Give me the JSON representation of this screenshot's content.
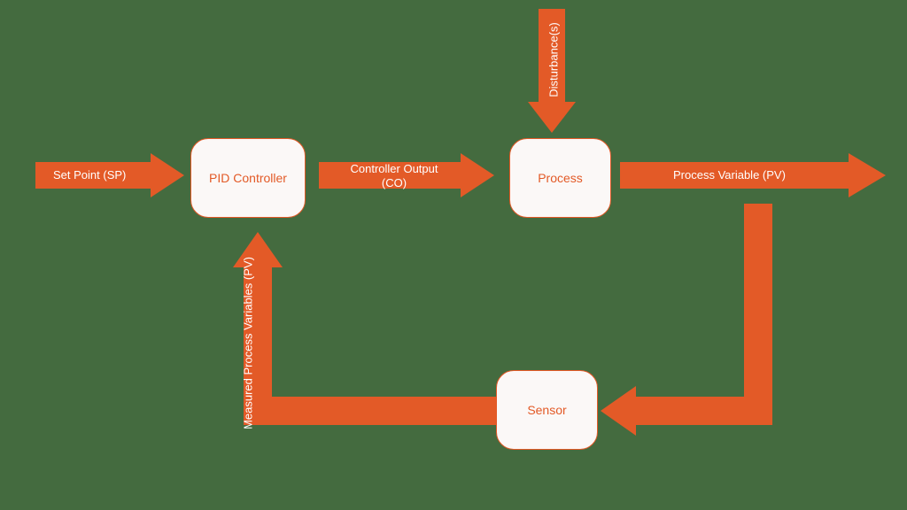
{
  "nodes": {
    "pid": "PID Controller",
    "process": "Process",
    "sensor": "Sensor"
  },
  "labels": {
    "setpoint": "Set Point (SP)",
    "controller_output": "Controller Output (CO)",
    "controller_output_line1": "Controller Output",
    "controller_output_line2": "(CO)",
    "process_variable": "Process Variable (PV)",
    "disturbance": "Disturbance(s)",
    "measured_pv": "Measured Process Variables (PV)"
  },
  "colors": {
    "bg": "#446b3f",
    "accent": "#e35a27",
    "node_fill": "#fbf8f7",
    "label": "#ffffff"
  }
}
